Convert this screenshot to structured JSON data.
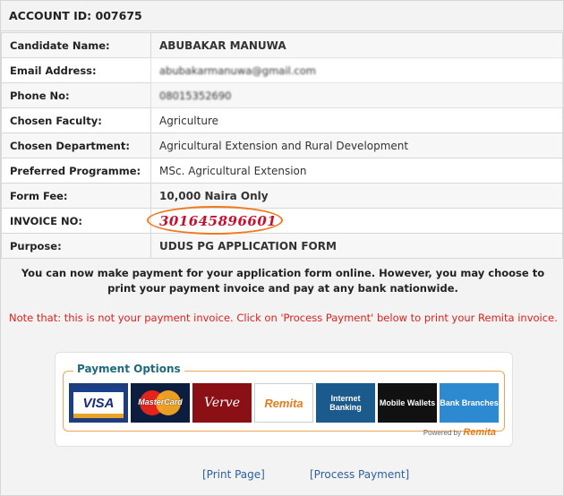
{
  "account": {
    "label": "ACCOUNT ID:",
    "id": "007675"
  },
  "rows": [
    {
      "key": "Candidate Name:",
      "value": "ABUBAKAR MANUWA"
    },
    {
      "key": "Email Address:",
      "value": "abubakarmanuwa@gmail.com"
    },
    {
      "key": "Phone No:",
      "value": "08015352690"
    },
    {
      "key": "Chosen Faculty:",
      "value": "Agriculture"
    },
    {
      "key": "Chosen Department:",
      "value": "Agricultural Extension and Rural Development"
    },
    {
      "key": "Preferred Programme:",
      "value": "MSc. Agricultural Extension"
    },
    {
      "key": "Form Fee:",
      "value": "10,000 Naira Only"
    },
    {
      "key": "INVOICE NO:",
      "value": "301645896601"
    },
    {
      "key": "Purpose:",
      "value": "UDUS PG APPLICATION FORM"
    }
  ],
  "message": "You can now make payment for your application form online. However, you may choose to print your payment invoice and pay at any bank nationwide.",
  "note": "Note that: this is not your payment invoice. Click on 'Process Payment' below to print your Remita invoice.",
  "payment": {
    "title": "Payment Options",
    "options": {
      "visa": "VISA",
      "mastercard": "MasterCard",
      "verve": "Verve",
      "remita": "Remita",
      "internet_banking": "Internet Banking",
      "mobile_wallets": "Mobile Wallets",
      "bank_branches": "Bank Branches"
    },
    "powered_by": "Powered by",
    "powered_brand": "Remita"
  },
  "links": {
    "print": "[Print Page]",
    "process": "[Process Payment]"
  },
  "colors": {
    "highlight_oval": "#f07a1e",
    "invoice_text": "#c8102e",
    "note_text": "#e0201a",
    "link": "#2c5fa0"
  }
}
